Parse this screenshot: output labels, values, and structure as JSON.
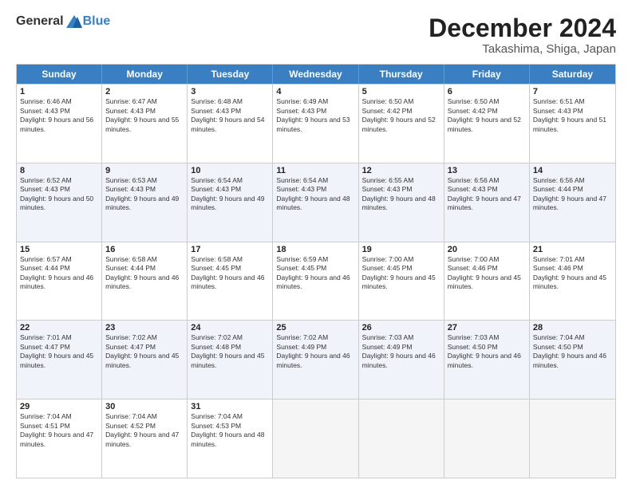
{
  "header": {
    "logo_general": "General",
    "logo_blue": "Blue",
    "month_title": "December 2024",
    "location": "Takashima, Shiga, Japan"
  },
  "weekdays": [
    "Sunday",
    "Monday",
    "Tuesday",
    "Wednesday",
    "Thursday",
    "Friday",
    "Saturday"
  ],
  "rows": [
    [
      {
        "day": "1",
        "sunrise": "6:46 AM",
        "sunset": "4:43 PM",
        "daylight": "9 hours and 56 minutes."
      },
      {
        "day": "2",
        "sunrise": "6:47 AM",
        "sunset": "4:43 PM",
        "daylight": "9 hours and 55 minutes."
      },
      {
        "day": "3",
        "sunrise": "6:48 AM",
        "sunset": "4:43 PM",
        "daylight": "9 hours and 54 minutes."
      },
      {
        "day": "4",
        "sunrise": "6:49 AM",
        "sunset": "4:43 PM",
        "daylight": "9 hours and 53 minutes."
      },
      {
        "day": "5",
        "sunrise": "6:50 AM",
        "sunset": "4:42 PM",
        "daylight": "9 hours and 52 minutes."
      },
      {
        "day": "6",
        "sunrise": "6:50 AM",
        "sunset": "4:42 PM",
        "daylight": "9 hours and 52 minutes."
      },
      {
        "day": "7",
        "sunrise": "6:51 AM",
        "sunset": "4:43 PM",
        "daylight": "9 hours and 51 minutes."
      }
    ],
    [
      {
        "day": "8",
        "sunrise": "6:52 AM",
        "sunset": "4:43 PM",
        "daylight": "9 hours and 50 minutes."
      },
      {
        "day": "9",
        "sunrise": "6:53 AM",
        "sunset": "4:43 PM",
        "daylight": "9 hours and 49 minutes."
      },
      {
        "day": "10",
        "sunrise": "6:54 AM",
        "sunset": "4:43 PM",
        "daylight": "9 hours and 49 minutes."
      },
      {
        "day": "11",
        "sunrise": "6:54 AM",
        "sunset": "4:43 PM",
        "daylight": "9 hours and 48 minutes."
      },
      {
        "day": "12",
        "sunrise": "6:55 AM",
        "sunset": "4:43 PM",
        "daylight": "9 hours and 48 minutes."
      },
      {
        "day": "13",
        "sunrise": "6:56 AM",
        "sunset": "4:43 PM",
        "daylight": "9 hours and 47 minutes."
      },
      {
        "day": "14",
        "sunrise": "6:56 AM",
        "sunset": "4:44 PM",
        "daylight": "9 hours and 47 minutes."
      }
    ],
    [
      {
        "day": "15",
        "sunrise": "6:57 AM",
        "sunset": "4:44 PM",
        "daylight": "9 hours and 46 minutes."
      },
      {
        "day": "16",
        "sunrise": "6:58 AM",
        "sunset": "4:44 PM",
        "daylight": "9 hours and 46 minutes."
      },
      {
        "day": "17",
        "sunrise": "6:58 AM",
        "sunset": "4:45 PM",
        "daylight": "9 hours and 46 minutes."
      },
      {
        "day": "18",
        "sunrise": "6:59 AM",
        "sunset": "4:45 PM",
        "daylight": "9 hours and 46 minutes."
      },
      {
        "day": "19",
        "sunrise": "7:00 AM",
        "sunset": "4:45 PM",
        "daylight": "9 hours and 45 minutes."
      },
      {
        "day": "20",
        "sunrise": "7:00 AM",
        "sunset": "4:46 PM",
        "daylight": "9 hours and 45 minutes."
      },
      {
        "day": "21",
        "sunrise": "7:01 AM",
        "sunset": "4:46 PM",
        "daylight": "9 hours and 45 minutes."
      }
    ],
    [
      {
        "day": "22",
        "sunrise": "7:01 AM",
        "sunset": "4:47 PM",
        "daylight": "9 hours and 45 minutes."
      },
      {
        "day": "23",
        "sunrise": "7:02 AM",
        "sunset": "4:47 PM",
        "daylight": "9 hours and 45 minutes."
      },
      {
        "day": "24",
        "sunrise": "7:02 AM",
        "sunset": "4:48 PM",
        "daylight": "9 hours and 45 minutes."
      },
      {
        "day": "25",
        "sunrise": "7:02 AM",
        "sunset": "4:49 PM",
        "daylight": "9 hours and 46 minutes."
      },
      {
        "day": "26",
        "sunrise": "7:03 AM",
        "sunset": "4:49 PM",
        "daylight": "9 hours and 46 minutes."
      },
      {
        "day": "27",
        "sunrise": "7:03 AM",
        "sunset": "4:50 PM",
        "daylight": "9 hours and 46 minutes."
      },
      {
        "day": "28",
        "sunrise": "7:04 AM",
        "sunset": "4:50 PM",
        "daylight": "9 hours and 46 minutes."
      }
    ],
    [
      {
        "day": "29",
        "sunrise": "7:04 AM",
        "sunset": "4:51 PM",
        "daylight": "9 hours and 47 minutes."
      },
      {
        "day": "30",
        "sunrise": "7:04 AM",
        "sunset": "4:52 PM",
        "daylight": "9 hours and 47 minutes."
      },
      {
        "day": "31",
        "sunrise": "7:04 AM",
        "sunset": "4:53 PM",
        "daylight": "9 hours and 48 minutes."
      },
      null,
      null,
      null,
      null
    ]
  ],
  "labels": {
    "sunrise_prefix": "Sunrise: ",
    "sunset_prefix": "Sunset: ",
    "daylight_prefix": "Daylight: "
  }
}
